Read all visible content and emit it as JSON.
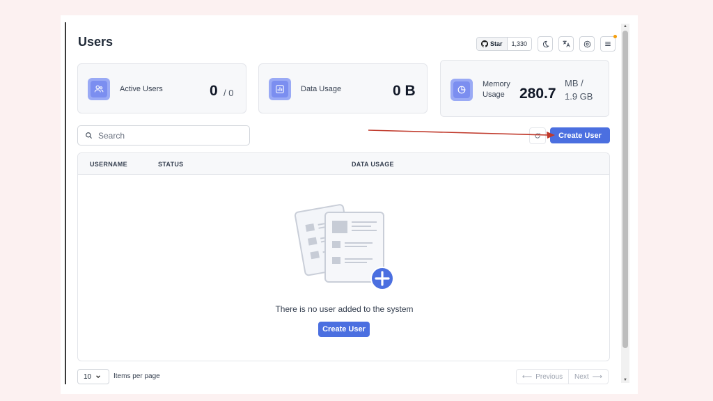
{
  "page": {
    "title": "Users"
  },
  "header": {
    "github": {
      "star_label": "Star",
      "count": "1,330"
    }
  },
  "stats": {
    "active_users": {
      "label": "Active Users",
      "value": "0",
      "total": "/ 0"
    },
    "data_usage": {
      "label": "Data Usage",
      "value": "0 B"
    },
    "memory_usage": {
      "label_line1": "Memory",
      "label_line2": "Usage",
      "value": "280.7",
      "unit_line1": "MB /",
      "unit_line2": "1.9 GB"
    }
  },
  "search": {
    "placeholder": "Search"
  },
  "toolbar": {
    "create_user_label": "Create User"
  },
  "table": {
    "columns": [
      "USERNAME",
      "STATUS",
      "DATA USAGE"
    ],
    "empty_message": "There is no user added to the system",
    "empty_create_label": "Create User"
  },
  "pagination": {
    "per_page_value": "10",
    "per_page_label": "Items per page",
    "previous_label": "Previous",
    "next_label": "Next"
  },
  "colors": {
    "primary": "#4b6fe0",
    "card_icon": "#9aaaf5",
    "annotation_arrow": "#c0392b",
    "page_background": "#fcf1f1"
  }
}
